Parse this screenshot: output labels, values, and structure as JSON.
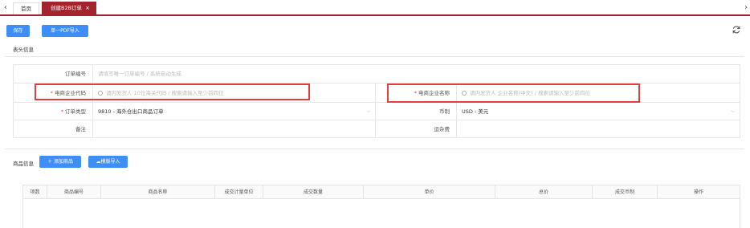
{
  "tabs": {
    "home": "首页",
    "active": "创建B2B订单",
    "close": "×"
  },
  "toolbar": {
    "save": "保存",
    "pdf_import": "单一PDF导入"
  },
  "header_section": {
    "title": "表头信息",
    "fields": {
      "order_no_label": "订单编号",
      "order_no_placeholder": "请填写唯一订单编号 / 系统自动生成",
      "ec_code_label": "电商企业代码",
      "ec_code_placeholder": "请内发货人 10位海关代码 / 搜索请输入至少前四位",
      "ec_name_label": "电商企业名称",
      "ec_name_placeholder": "请内发货人 企业名称(中文) / 搜索请输入至少前四位",
      "order_type_label": "订单类型",
      "order_type_value": "9810 - 海外仓出口商品订单",
      "currency_label": "币制",
      "currency_value": "USD - 美元",
      "remark_label": "备注",
      "freight_label": "运杂费",
      "required_mark": "*"
    }
  },
  "goods_section": {
    "title": "商品信息",
    "add_goods": "添加商品",
    "template_import": "模版导入",
    "columns": [
      "项数",
      "商品编号",
      "商品名称",
      "成交计量单位",
      "成交数量",
      "单价",
      "总价",
      "成交币制",
      "操作"
    ]
  },
  "colors": {
    "tab_active": "#a3242c",
    "button": "#3e8ef7",
    "highlight": "#e53e3e"
  }
}
